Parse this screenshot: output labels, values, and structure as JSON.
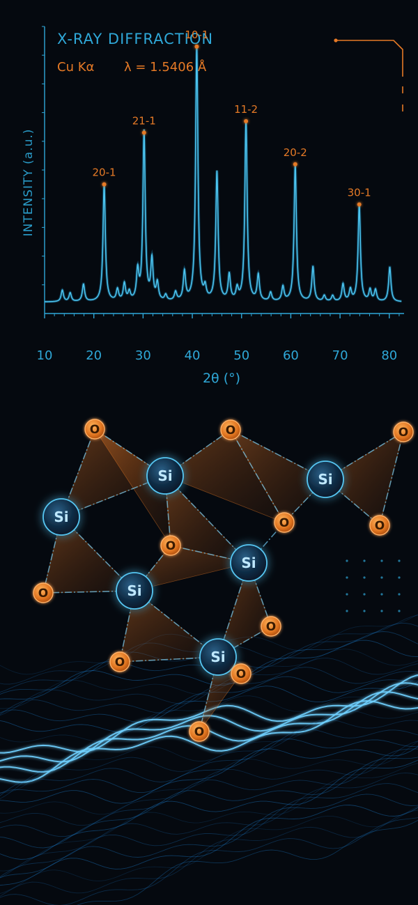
{
  "colors": {
    "background": "#05090f",
    "cyan": "#2fa8d8",
    "orange": "#e67a26",
    "wave": "#1d7fd0"
  },
  "header": {
    "title": "X-RAY DIFFRACTION",
    "source": "Cu Kα",
    "wavelength": "λ = 1.5406 Å"
  },
  "chart_data": {
    "type": "line",
    "title": "X-RAY DIFFRACTION",
    "subtitle": "Cu Kα    λ = 1.5406 Å",
    "xlabel": "2θ (°)",
    "ylabel": "INTENSITY (a.u.)",
    "xlim": [
      10,
      83
    ],
    "ylim": [
      0,
      100
    ],
    "xticks": [
      10,
      20,
      30,
      40,
      50,
      60,
      70,
      80
    ],
    "grid": false,
    "baseline": 4,
    "peaks": [
      {
        "x": 13.6,
        "y": 8
      },
      {
        "x": 15.2,
        "y": 7
      },
      {
        "x": 17.9,
        "y": 10
      },
      {
        "x": 22.1,
        "y": 45
      },
      {
        "x": 24.8,
        "y": 8
      },
      {
        "x": 26.2,
        "y": 10
      },
      {
        "x": 27.2,
        "y": 7
      },
      {
        "x": 28.9,
        "y": 14
      },
      {
        "x": 30.2,
        "y": 63
      },
      {
        "x": 31.8,
        "y": 18
      },
      {
        "x": 32.9,
        "y": 10
      },
      {
        "x": 34.6,
        "y": 6
      },
      {
        "x": 36.6,
        "y": 7
      },
      {
        "x": 38.4,
        "y": 14
      },
      {
        "x": 40.9,
        "y": 93
      },
      {
        "x": 42.6,
        "y": 8
      },
      {
        "x": 45.0,
        "y": 49
      },
      {
        "x": 47.5,
        "y": 13
      },
      {
        "x": 49.1,
        "y": 8
      },
      {
        "x": 50.9,
        "y": 67
      },
      {
        "x": 53.4,
        "y": 13
      },
      {
        "x": 55.9,
        "y": 7
      },
      {
        "x": 58.4,
        "y": 9
      },
      {
        "x": 60.9,
        "y": 52
      },
      {
        "x": 64.5,
        "y": 16
      },
      {
        "x": 66.8,
        "y": 6
      },
      {
        "x": 68.5,
        "y": 6
      },
      {
        "x": 70.6,
        "y": 10
      },
      {
        "x": 72.1,
        "y": 8
      },
      {
        "x": 73.9,
        "y": 38
      },
      {
        "x": 76.1,
        "y": 8
      },
      {
        "x": 77.2,
        "y": 8
      },
      {
        "x": 80.1,
        "y": 16
      }
    ],
    "annotations": [
      {
        "label": "20-1",
        "x": 22.1,
        "y": 45
      },
      {
        "label": "21-1",
        "x": 30.2,
        "y": 63
      },
      {
        "label": "10-1",
        "x": 40.9,
        "y": 93
      },
      {
        "label": "11-2",
        "x": 50.9,
        "y": 67
      },
      {
        "label": "20-2",
        "x": 60.9,
        "y": 52
      },
      {
        "label": "30-1",
        "x": 73.9,
        "y": 38
      }
    ]
  },
  "molecule": {
    "atoms": [
      {
        "id": "si1",
        "label": "Si"
      },
      {
        "id": "si2",
        "label": "Si"
      },
      {
        "id": "si3",
        "label": "Si"
      },
      {
        "id": "si4",
        "label": "Si"
      },
      {
        "id": "si5",
        "label": "Si"
      },
      {
        "id": "si6",
        "label": "Si"
      },
      {
        "id": "o1",
        "label": "O"
      },
      {
        "id": "o2",
        "label": "O"
      },
      {
        "id": "o3",
        "label": "O"
      },
      {
        "id": "o4",
        "label": "O"
      },
      {
        "id": "o5",
        "label": "O"
      },
      {
        "id": "o6",
        "label": "O"
      },
      {
        "id": "o7",
        "label": "O"
      },
      {
        "id": "o8",
        "label": "O"
      },
      {
        "id": "o9",
        "label": "O"
      },
      {
        "id": "o10",
        "label": "O"
      },
      {
        "id": "o11",
        "label": "O"
      }
    ]
  }
}
